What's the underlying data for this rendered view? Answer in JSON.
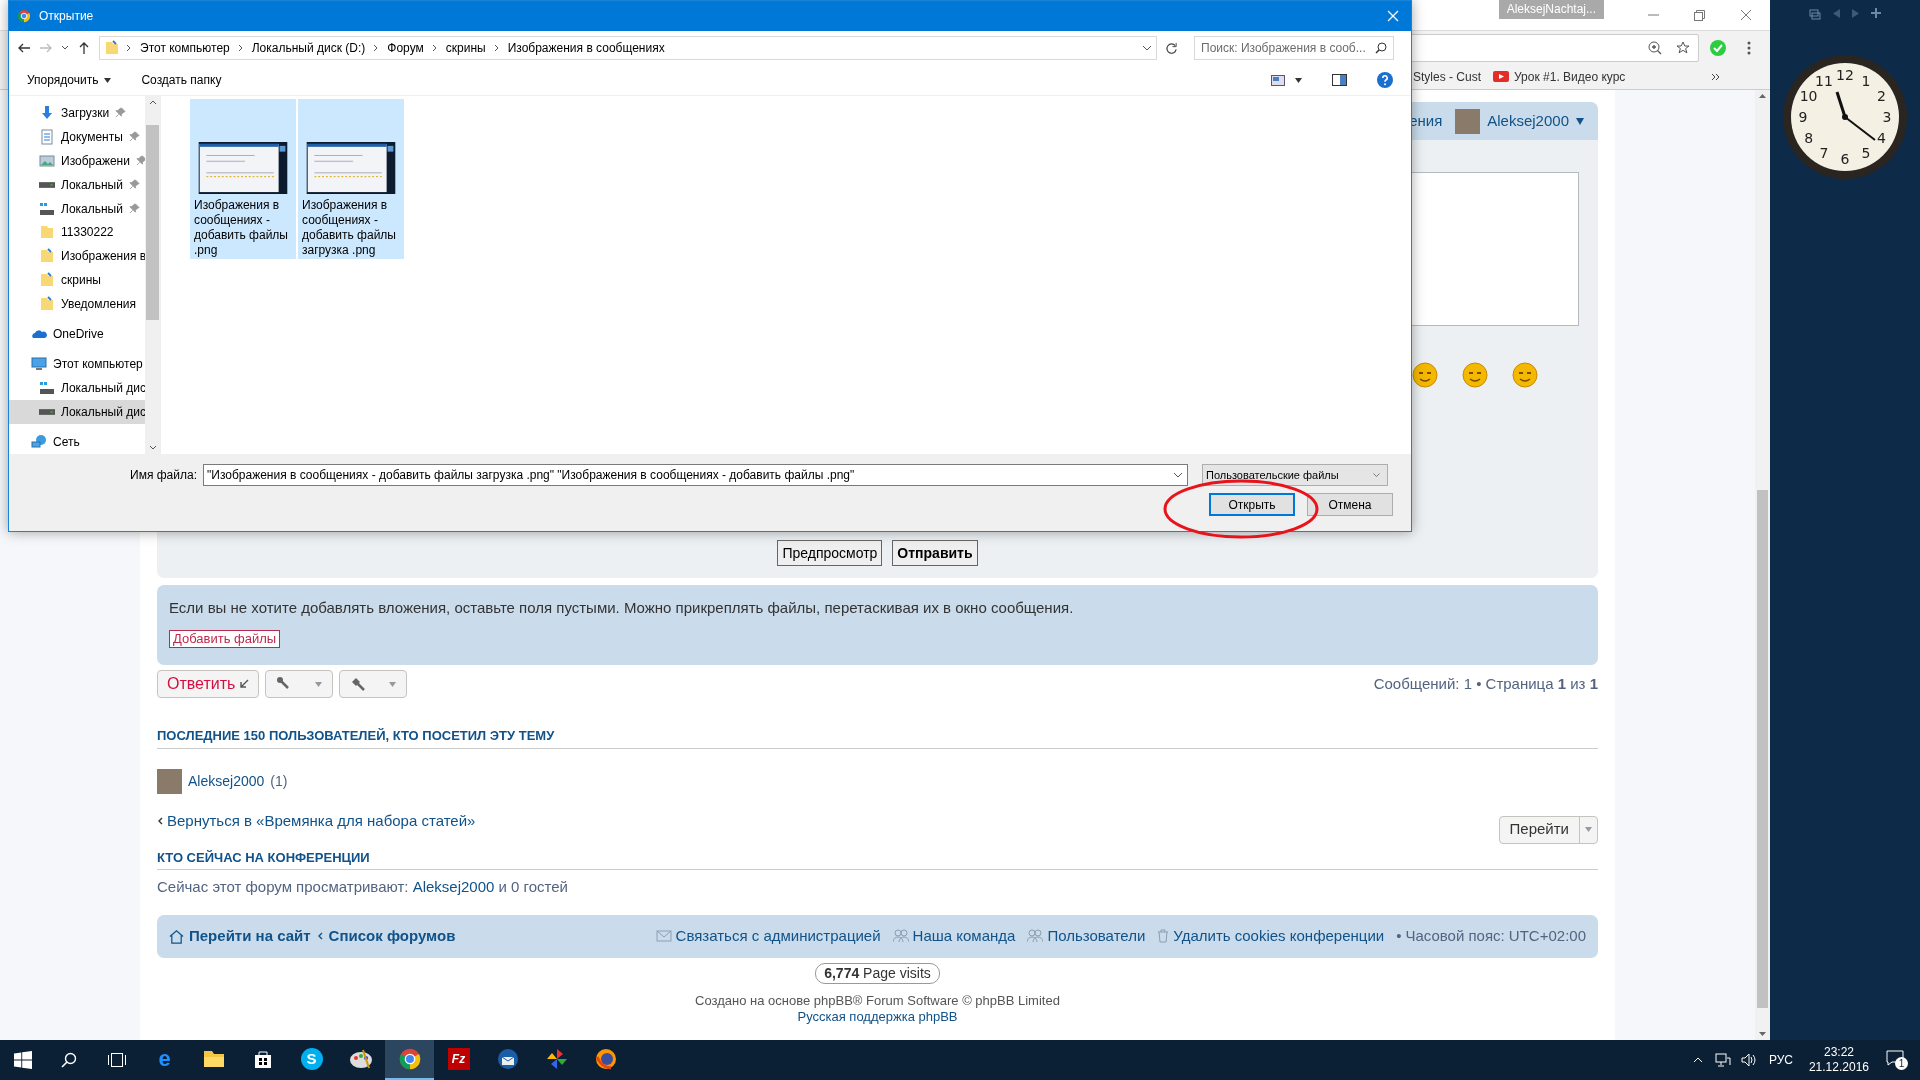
{
  "dialog": {
    "title": "Открытие",
    "path": [
      "Этот компьютер",
      "Локальный диск (D:)",
      "Форум",
      "скрины",
      "Изображения в сообщениях"
    ],
    "search_placeholder": "Поиск: Изображения в сооб...",
    "toolbar": [
      "Упорядочить",
      "Создать папку"
    ],
    "quick_access": [
      {
        "label": "Загрузки",
        "kind": "downloads",
        "pinned": true,
        "selected": false
      },
      {
        "label": "Документы",
        "kind": "documents",
        "pinned": true,
        "selected": false
      },
      {
        "label": "Изображени",
        "kind": "pictures",
        "pinned": true,
        "selected": false
      },
      {
        "label": "Локальный",
        "kind": "drive",
        "pinned": true,
        "selected": false
      },
      {
        "label": "Локальный",
        "kind": "drive-win",
        "pinned": true,
        "selected": false
      },
      {
        "label": "11330222",
        "kind": "folder",
        "pinned": false,
        "selected": false
      },
      {
        "label": "Изображения в",
        "kind": "folder-shared",
        "pinned": false,
        "selected": false
      },
      {
        "label": "скрины",
        "kind": "folder-shared",
        "pinned": false,
        "selected": false
      },
      {
        "label": "Уведомления",
        "kind": "folder-shared",
        "pinned": false,
        "selected": false
      }
    ],
    "locations": [
      {
        "label": "OneDrive",
        "kind": "cloud",
        "selected": false
      },
      {
        "label": "Этот компьютер",
        "kind": "computer",
        "selected": false,
        "children": [
          {
            "label": "Локальный дис",
            "kind": "drive-win",
            "selected": false
          },
          {
            "label": "Локальный дис",
            "kind": "drive",
            "selected": true
          }
        ]
      },
      {
        "label": "Сеть",
        "kind": "network",
        "selected": false
      }
    ],
    "files": [
      {
        "name": "Изображения в сообщениях - добавить файлы .png",
        "selected": true
      },
      {
        "name": "Изображения в сообщениях - добавить файлы загрузка .png",
        "selected": true
      }
    ],
    "filename_label": "Имя файла:",
    "filename": "\"Изображения в сообщениях - добавить файлы загрузка .png\" \"Изображения в сообщениях - добавить файлы .png\"",
    "filetype": "Пользовательские файлы",
    "buttons": [
      {
        "label": "Открыть",
        "kind": "primary"
      },
      {
        "label": "Отмена",
        "kind": "normal"
      }
    ]
  },
  "browser": {
    "profile": "AleksejNachtaj...",
    "bookmarks": [
      {
        "label": "Styles - Cust",
        "kind": "plain"
      },
      {
        "label": "Урок #1. Видео курс",
        "kind": "video"
      }
    ]
  },
  "forum": {
    "header_text": "ения",
    "user": "Aleksej2000",
    "buttons": [
      "Предпросмотр",
      "Отправить"
    ],
    "attach_info": "Если вы не хотите добавлять вложения, оставьте поля пустыми. Можно прикреплять файлы, перетаскивая их в окно сообщения.",
    "add_files": "Добавить файлы",
    "reply": "Ответить",
    "pagination": "Сообщений: 1 • Страница **1** из **1**",
    "visitors_heading": "ПОСЛЕДНИЕ 150 ПОЛЬЗОВАТЕЛЕЙ, КТО ПОСЕТИЛ ЭТУ ТЕМУ",
    "visitor": {
      "name": "Aleksej2000",
      "count": "(1)"
    },
    "back_link": "Вернуться в «Времянка для набора статей»",
    "jump": "Перейти",
    "online_heading": "КТО СЕЙЧАС НА КОНФЕРЕНЦИИ",
    "online": {
      "before": "Сейчас этот форум просматривают:",
      "user": "Aleksej2000",
      "after": "и 0 гостей"
    },
    "footer_left": [
      "Перейти на сайт",
      "Список форумов"
    ],
    "footer_right": [
      {
        "label": "Связаться с администрацией",
        "kind": "mail"
      },
      {
        "label": "Наша команда",
        "kind": "team"
      },
      {
        "label": "Пользователи",
        "kind": "users"
      },
      {
        "label": "Удалить cookies конференции",
        "kind": "trash"
      },
      {
        "label": "Часовой пояс: UTC+02:00",
        "kind": "bullet",
        "mark": "•"
      }
    ],
    "visits": "**6,774** Page visits",
    "credits": [
      "Создано на основе phpBB® Forum Software © phpBB Limited",
      "Русская поддержка phpBB"
    ]
  },
  "clock": {
    "numerals": [
      "11",
      "12",
      "1",
      "10",
      "2",
      "9",
      "3",
      "8",
      "4",
      "7",
      "5",
      "6"
    ]
  },
  "taskbar": {
    "apps": [
      {
        "kind": "edge",
        "glyph": "e",
        "selected": false
      },
      {
        "kind": "folder",
        "selected": false
      },
      {
        "kind": "store",
        "selected": false
      },
      {
        "kind": "skype",
        "glyph": "S",
        "selected": false
      },
      {
        "kind": "paint",
        "selected": false
      },
      {
        "kind": "chrome",
        "selected": true
      },
      {
        "kind": "ftp",
        "glyph": "Fz",
        "selected": false
      },
      {
        "kind": "mail",
        "selected": false
      },
      {
        "kind": "pinwheel",
        "selected": false
      },
      {
        "kind": "firefox",
        "selected": false
      }
    ],
    "language": "РУС",
    "time": "23:22",
    "date": "21.12.2016",
    "notifications": "1"
  }
}
